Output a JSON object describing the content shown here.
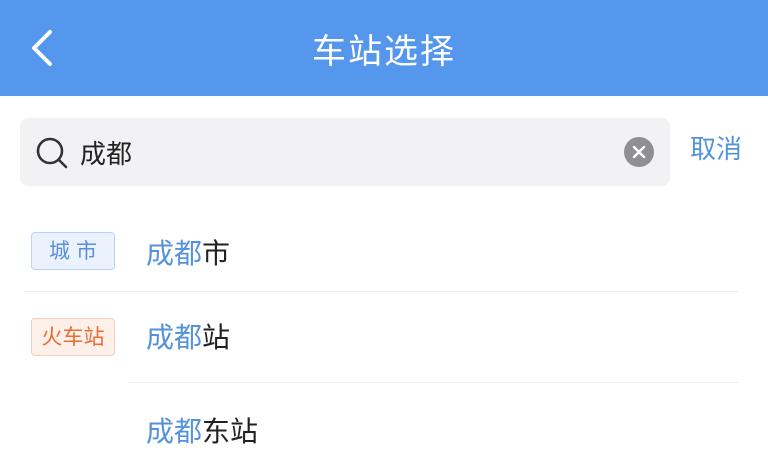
{
  "header": {
    "title": "车站选择",
    "background_color": "#5697ee"
  },
  "search": {
    "value": "成都",
    "placeholder": "",
    "cancel_label": "取消"
  },
  "results": [
    {
      "tag": "城市",
      "tag_type": "city",
      "highlight": "成都",
      "rest": "市"
    },
    {
      "tag": "火车站",
      "tag_type": "station",
      "highlight": "成都",
      "rest": "站"
    },
    {
      "tag": "",
      "tag_type": "none",
      "highlight": "成都",
      "rest": "东站"
    }
  ],
  "colors": {
    "accent": "#5592dc",
    "city_tag": "#5b8fd6",
    "station_tag": "#e86c36"
  }
}
